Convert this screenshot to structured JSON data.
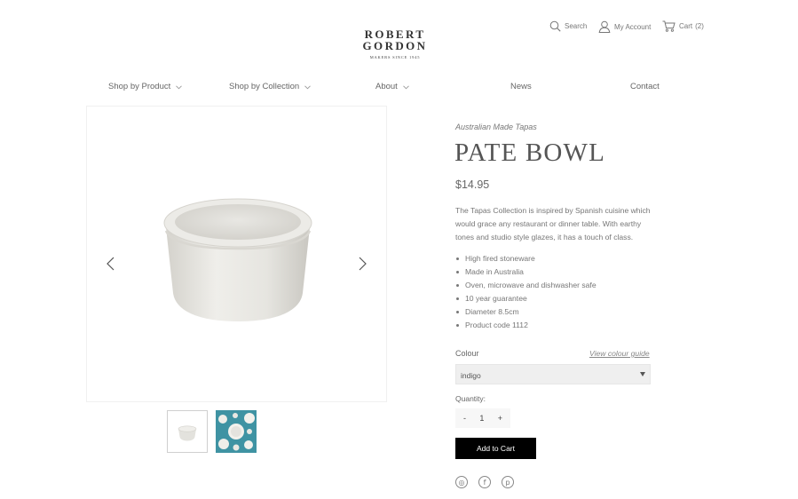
{
  "header": {
    "logo_line1": "ROBERT",
    "logo_line2": "GORDON",
    "logo_tagline": "MAKERS SINCE 1945",
    "search_label": "Search",
    "account_label": "My Account",
    "cart_label": "Cart",
    "cart_count": "(2)"
  },
  "nav": {
    "items": [
      {
        "label": "Shop by Product",
        "dropdown": true
      },
      {
        "label": "Shop by Collection",
        "dropdown": true
      },
      {
        "label": "About",
        "dropdown": true
      },
      {
        "label": "News",
        "dropdown": false
      },
      {
        "label": "Contact",
        "dropdown": false
      }
    ]
  },
  "gallery": {
    "prev_icon": "chevron-left-icon",
    "next_icon": "chevron-right-icon",
    "thumbnail_count": 2
  },
  "product": {
    "collection": "Australian Made Tapas",
    "title": "PATE BOWL",
    "price": "$14.95",
    "description": "The Tapas Collection is inspired by Spanish cuisine which would grace any restaurant or dinner table. With earthy tones and studio style glazes, it has a touch of class.",
    "features": [
      "High fired stoneware",
      "Made in Australia",
      "Oven, microwave and dishwasher safe",
      "10 year guarantee",
      "Diameter 8.5cm",
      "Product code 1112"
    ]
  },
  "options": {
    "colour_label": "Colour",
    "colour_guide_link": "View colour guide",
    "colour_selected": "indigo",
    "quantity_label": "Quantity:",
    "quantity_minus": "-",
    "quantity_value": "1",
    "quantity_plus": "+",
    "add_to_cart": "Add to Cart"
  },
  "social": {
    "instagram_glyph": "◎",
    "facebook_glyph": "f",
    "pinterest_glyph": "p"
  },
  "colors": {
    "button_bg": "#000000",
    "thumb_bg": "#3f93a3",
    "select_bg": "#efefef"
  }
}
